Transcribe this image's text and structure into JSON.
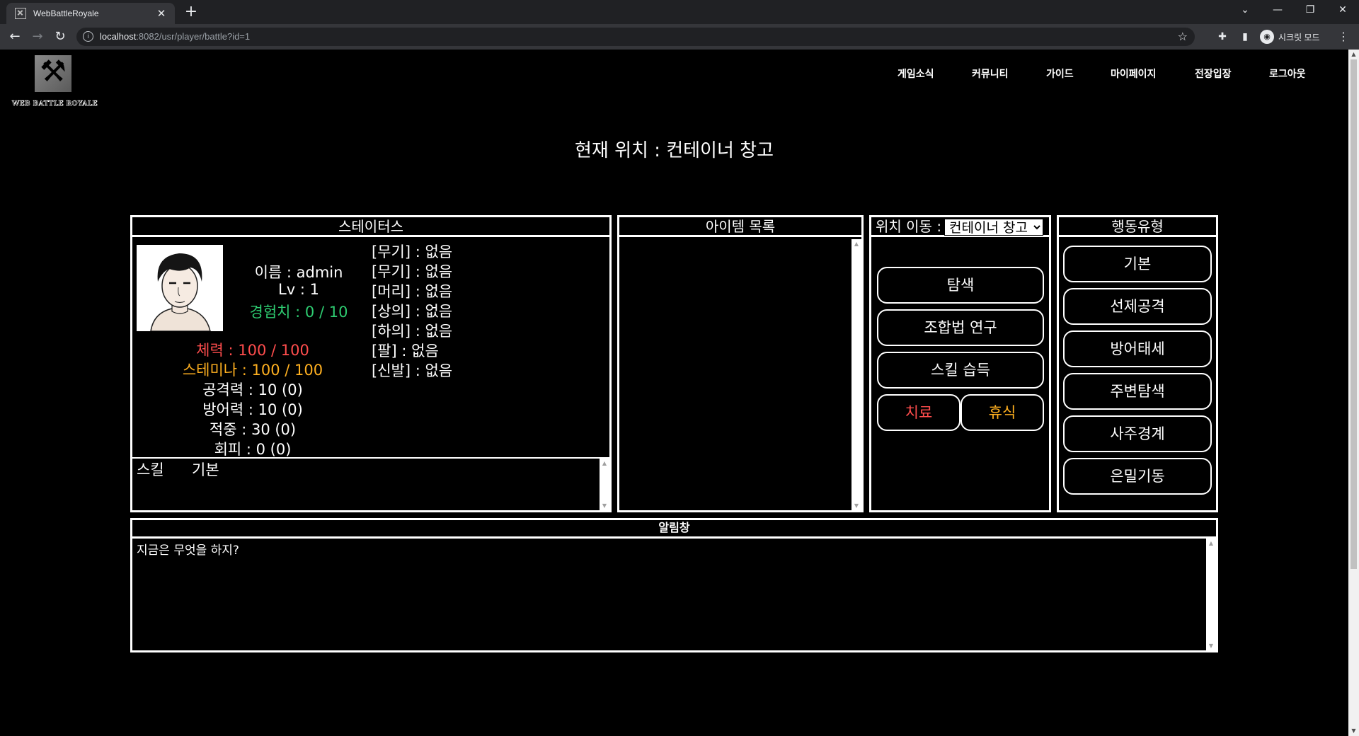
{
  "browser": {
    "tab_title": "WebBattleRoyale",
    "url_host": "localhost",
    "url_rest": ":8082/usr/player/battle?id=1",
    "profile_label": "시크릿 모드"
  },
  "site": {
    "logo_text": "WEB BATTLE ROYALE",
    "nav": [
      "게임소식",
      "커뮤니티",
      "가이드",
      "마이페이지",
      "전장입장",
      "로그아웃"
    ]
  },
  "location_title": "현재 위치 : 컨테이너 창고",
  "status": {
    "header": "스테이터스",
    "name": "이름 : admin",
    "level": "Lv : 1",
    "exp": "경험치 : 0 / 10",
    "hp": "체력 : 100 / 100",
    "stamina": "스테미나 : 100 / 100",
    "attack": "공격력 : 10 (0)",
    "defense": "방어력 : 10 (0)",
    "accuracy": "적중 : 30 (0)",
    "evasion": "회피 : 0 (0)",
    "equipment": [
      "[무기] : 없음",
      "[무기] : 없음",
      "[머리] : 없음",
      "[상의] : 없음",
      "[하의] : 없음",
      "[팔] : 없음",
      "[신발] : 없음"
    ],
    "skill_label": "스킬",
    "skill_value": "기본",
    "colors": {
      "exp": "#2ecc71",
      "hp": "#ff4d4d",
      "stamina": "#ffb020"
    }
  },
  "items": {
    "header": "아이템 목록"
  },
  "move": {
    "label": "위치 이동 :",
    "selected": "컨테이너 창고",
    "explore": "탐색",
    "recipe": "조합법 연구",
    "skill": "스킬 습득",
    "heal": "치료",
    "rest": "휴식",
    "colors": {
      "heal": "#ff4d4d",
      "rest": "#ffb020"
    }
  },
  "action": {
    "header": "행동유형",
    "options": [
      "기본",
      "선제공격",
      "방어태세",
      "주변탐색",
      "사주경계",
      "은밀기동"
    ]
  },
  "notice": {
    "header": "알림창",
    "message": "지금은 무엇을 하지?"
  }
}
